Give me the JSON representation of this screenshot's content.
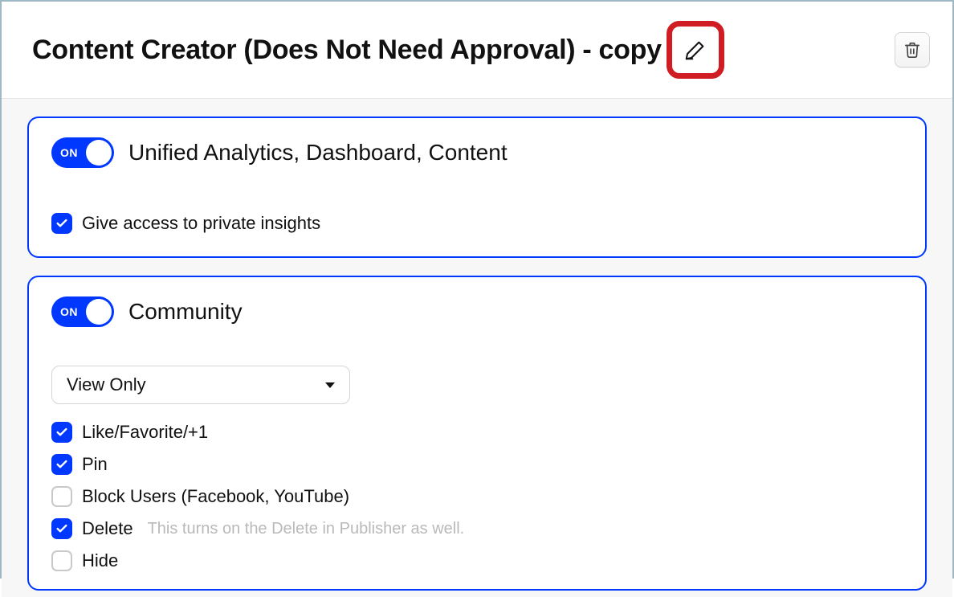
{
  "header": {
    "title": "Content Creator (Does Not Need Approval) - copy"
  },
  "toggle": {
    "on_label": "ON"
  },
  "card1": {
    "title": "Unified Analytics, Dashboard, Content",
    "private_insights_label": "Give access to private insights"
  },
  "card2": {
    "title": "Community",
    "select_value": "View Only",
    "perm_like": "Like/Favorite/+1",
    "perm_pin": "Pin",
    "perm_block": "Block Users (Facebook, YouTube)",
    "perm_delete": "Delete",
    "perm_delete_hint": "This turns on the Delete in Publisher as well.",
    "perm_hide": "Hide"
  }
}
